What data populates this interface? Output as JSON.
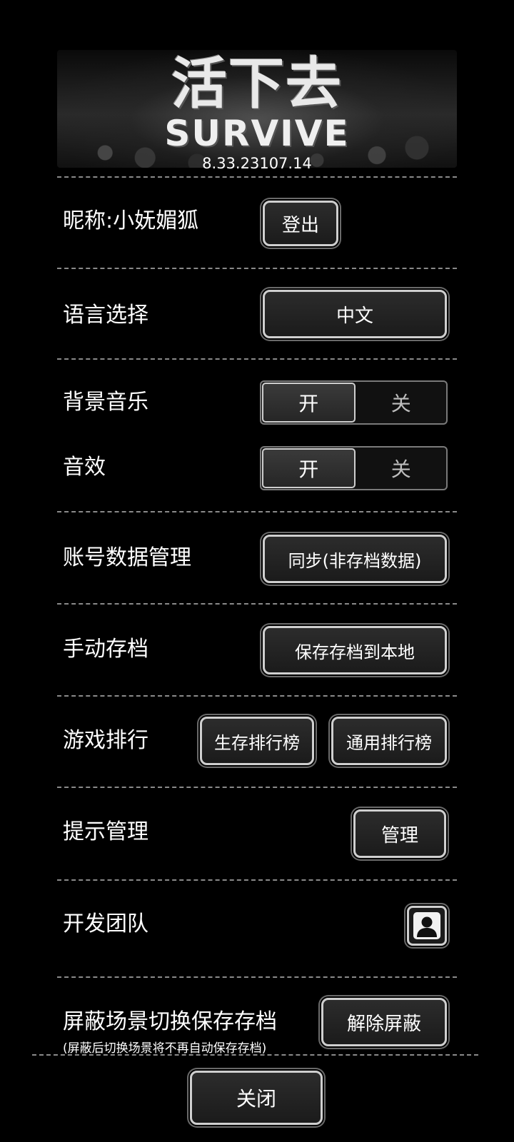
{
  "header": {
    "logo_cn": "活下去",
    "logo_en": "SURVIVE",
    "version": "8.33.23107.14"
  },
  "rows": {
    "nickname": {
      "label": "昵称:小妩媚狐",
      "button": "登出"
    },
    "language": {
      "label": "语言选择",
      "button": "中文"
    },
    "bgm": {
      "label": "背景音乐",
      "on": "开",
      "off": "关",
      "state": "on"
    },
    "sfx": {
      "label": "音效",
      "on": "开",
      "off": "关",
      "state": "on"
    },
    "account": {
      "label": "账号数据管理",
      "button": "同步(非存档数据)"
    },
    "manual_save": {
      "label": "手动存档",
      "button": "保存存档到本地"
    },
    "ranking": {
      "label": "游戏排行",
      "button_survival": "生存排行榜",
      "button_general": "通用排行榜"
    },
    "tips": {
      "label": "提示管理",
      "button": "管理"
    },
    "dev_team": {
      "label": "开发团队",
      "icon": "person-icon"
    },
    "block_save": {
      "label": "屏蔽场景切换保存存档",
      "sublabel": "(屏蔽后切换场景将不再自动保存存档)",
      "button": "解除屏蔽"
    }
  },
  "footer": {
    "close": "关闭"
  },
  "colors": {
    "background": "#000000",
    "button_border": "#cfcfcf",
    "divider": "#8a8a8a",
    "text": "#ffffff"
  }
}
